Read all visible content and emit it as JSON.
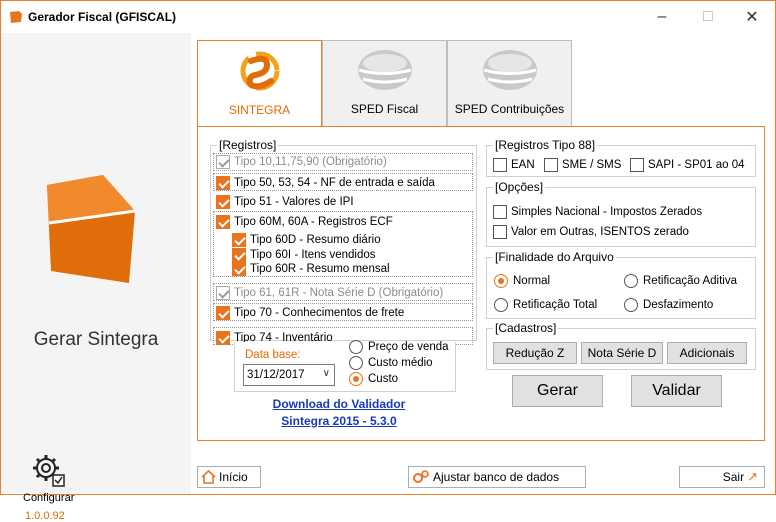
{
  "window": {
    "title": "Gerador Fiscal (GFISCAL)"
  },
  "left": {
    "gerar_label": "Gerar Sintegra",
    "config_label": "Configurar",
    "version": "1.0.0.92"
  },
  "tabs": [
    {
      "label": "SINTEGRA",
      "active": true
    },
    {
      "label": "SPED Fiscal",
      "active": false
    },
    {
      "label": "SPED Contribuições",
      "active": false
    }
  ],
  "registros": {
    "legend": "[Registros]",
    "items": [
      {
        "label": "Tipo 10,11,75,90 (Obrigatório)",
        "checked": true,
        "disabled": true
      },
      {
        "label": "Tipo 50, 53, 54 - NF de entrada e saída",
        "checked": true
      },
      {
        "label": "Tipo 51 - Valores de IPI",
        "checked": true
      },
      {
        "label": "Tipo 60M, 60A - Registros ECF",
        "checked": true
      },
      {
        "label": "Tipo 60D - Resumo diário",
        "checked": true
      },
      {
        "label": "Tipo 60I  - Itens vendidos",
        "checked": true
      },
      {
        "label": "Tipo 60R - Resumo mensal",
        "checked": true
      },
      {
        "label": "Tipo 61, 61R - Nota Série D (Obrigatório)",
        "checked": true,
        "disabled": true
      },
      {
        "label": "Tipo 70 - Conhecimentos de frete",
        "checked": true
      },
      {
        "label": "Tipo 74 - Inventário",
        "checked": true
      }
    ]
  },
  "inventario": {
    "date_label": "Data base:",
    "date_value": "31/12/2017",
    "options": [
      "Preço de venda",
      "Custo médio",
      "Custo"
    ],
    "selected": "Custo"
  },
  "validador_link": {
    "line1": "Download do Validador",
    "line2": "Sintegra 2015 - 5.3.0"
  },
  "tipo88": {
    "legend": "[Registros Tipo 88]",
    "items": [
      {
        "label": "EAN",
        "checked": false
      },
      {
        "label": "SME / SMS",
        "checked": false
      },
      {
        "label": "SAPI - SP01 ao 04",
        "checked": false
      }
    ]
  },
  "opcoes": {
    "legend": "[Opções]",
    "items": [
      {
        "label": "Simples Nacional - Impostos Zerados",
        "checked": false
      },
      {
        "label": "Valor em Outras, ISENTOS zerado",
        "checked": false
      }
    ]
  },
  "finalidade": {
    "legend": "[Finalidade do Arquivo",
    "options": [
      "Normal",
      "Retificação Aditiva",
      "Retificação Total",
      "Desfazimento"
    ],
    "selected": "Normal"
  },
  "cadastros": {
    "legend": "[Cadastros]",
    "buttons": [
      "Redução Z",
      "Nota Série D",
      "Adicionais"
    ]
  },
  "actions": {
    "gerar": "Gerar",
    "validar": "Validar"
  },
  "bottom": {
    "inicio": "Início",
    "ajustar": "Ajustar banco de dados",
    "sair": "Sair"
  },
  "colors": {
    "accent": "#e8741f",
    "link": "#1a39b8"
  }
}
